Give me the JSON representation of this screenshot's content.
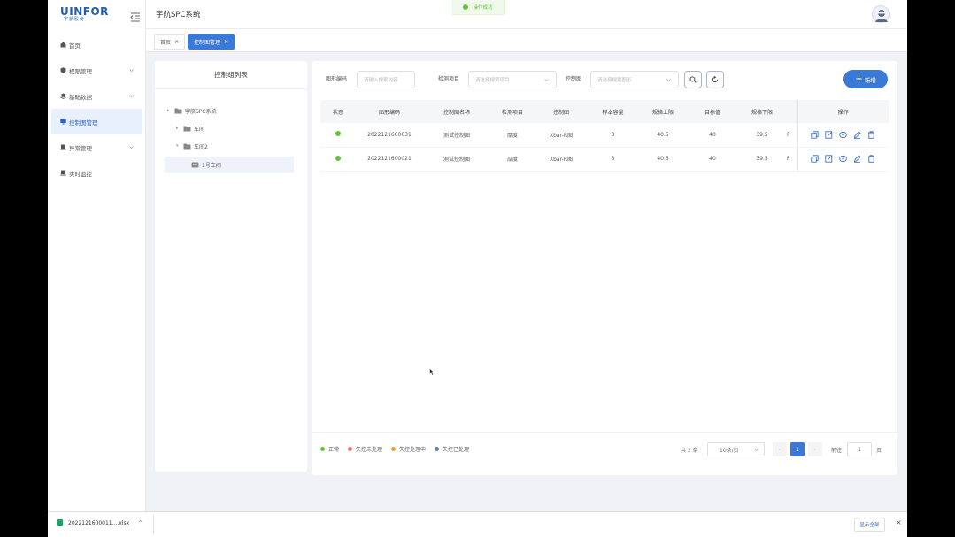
{
  "app": {
    "logo_text": "UINFOR",
    "logo_sub": "宇航股份",
    "title": "宇航SPC系统"
  },
  "toast": {
    "text": "操作成功"
  },
  "sidebar": {
    "items": [
      {
        "label": "首页",
        "icon": "home-icon",
        "has_arrow": false
      },
      {
        "label": "权限管理",
        "icon": "shield-icon",
        "has_arrow": true
      },
      {
        "label": "基础数据",
        "icon": "layers-icon",
        "has_arrow": true
      },
      {
        "label": "控制图管理",
        "icon": "monitor-icon",
        "has_arrow": false,
        "active": true
      },
      {
        "label": "异常管理",
        "icon": "alert-icon",
        "has_arrow": true
      },
      {
        "label": "实时监控",
        "icon": "camera-icon",
        "has_arrow": false
      }
    ]
  },
  "tabs": [
    {
      "label": "首页",
      "close": "×"
    },
    {
      "label": "控制图管理",
      "close": "×",
      "active": true
    }
  ],
  "tree": {
    "title": "控制组列表",
    "nodes": [
      {
        "label": "宇航SPC系统",
        "caret": "▸"
      },
      {
        "label": "车间",
        "caret": "▸"
      },
      {
        "label": "车间2",
        "caret": "▾"
      },
      {
        "label": "1号车间",
        "caret": "",
        "selected": true
      }
    ]
  },
  "filters": {
    "code_label": "图形编码",
    "code_placeholder": "请输入搜索内容",
    "item_label": "检测项目",
    "item_placeholder": "请选择搜索项目",
    "chart_label": "控制图",
    "chart_placeholder": "请选择搜索图形",
    "add_label": "新增",
    "add_plus": "+"
  },
  "table": {
    "columns": [
      "状态",
      "图形编码",
      "控制图名称",
      "检测项目",
      "控制图",
      "样本容量",
      "规格上限",
      "目标值",
      "规格下限",
      "",
      "操作"
    ],
    "rows": [
      {
        "status": "正常",
        "code": "2022121600031",
        "name": "测试控制图",
        "item": "厚度",
        "chart": "Xbar-R图",
        "sample": "3",
        "usl": "40.5",
        "target": "40",
        "lsl": "39.5",
        "extra": "F"
      },
      {
        "status": "正常",
        "code": "2022121600021",
        "name": "测试控制图",
        "item": "厚度",
        "chart": "Xbar-R图",
        "sample": "3",
        "usl": "40.5",
        "target": "40",
        "lsl": "39.5",
        "extra": "F"
      }
    ]
  },
  "legend": [
    {
      "label": "正常",
      "color": "#67c23a"
    },
    {
      "label": "失控未处理",
      "color": "#f56c6c"
    },
    {
      "label": "失控处理中",
      "color": "#e6a23c"
    },
    {
      "label": "失控已处理",
      "color": "#5b7fa6"
    }
  ],
  "pagination": {
    "total": "共 2 条",
    "page_size": "10条/页",
    "prev": "‹",
    "current": "1",
    "next": "›",
    "goto_label": "前往",
    "goto_value": "1",
    "page_unit": "页"
  },
  "download": {
    "file": "2022121600011....xlsx",
    "chevron": "^",
    "show_all": "显示全部",
    "close": "×"
  },
  "colors": {
    "primary": "#3b79d6",
    "success": "#67c23a"
  }
}
